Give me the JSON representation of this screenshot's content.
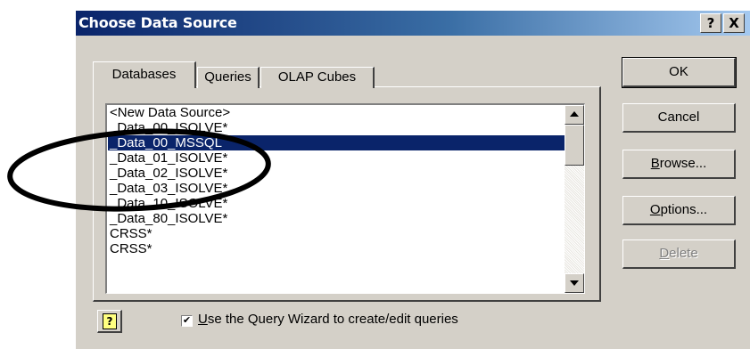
{
  "dialog": {
    "title": "Choose Data Source",
    "help_glyph": "?",
    "close_glyph": "X"
  },
  "tabs": [
    {
      "label": "Databases",
      "active": true
    },
    {
      "label": "Queries",
      "active": false
    },
    {
      "label": "OLAP Cubes",
      "active": false
    }
  ],
  "list": {
    "items": [
      "<New Data Source>",
      "_Data_00_ISOLVE*",
      "_Data_00_MSSQL",
      "_Data_01_ISOLVE*",
      "_Data_02_ISOLVE*",
      "_Data_03_ISOLVE*",
      "_Data_10_ISOLVE*",
      "_Data_80_ISOLVE*",
      "CRSS*",
      "CRSS*"
    ],
    "selected_index": 2
  },
  "buttons": {
    "ok": "OK",
    "cancel": "Cancel",
    "browse_accel": "B",
    "browse_rest": "rowse...",
    "options_accel": "O",
    "options_rest": "ptions...",
    "delete_accel": "D",
    "delete_rest": "elete"
  },
  "wizard": {
    "checked": true,
    "check_glyph": "✔",
    "label_accel": "U",
    "label_rest": "se the Query Wizard to create/edit queries"
  },
  "help_button": {
    "glyph": "?"
  },
  "colors": {
    "title_gradient_start": "#0a246a",
    "title_gradient_end": "#a6caf0",
    "selection": "#0a246a",
    "face": "#d4d0c8",
    "annotation": "#000000"
  }
}
